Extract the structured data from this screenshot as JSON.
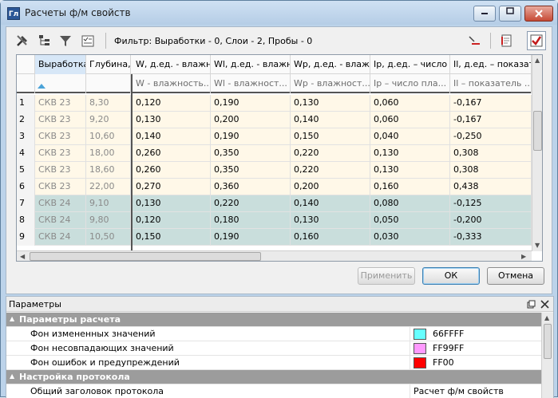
{
  "window": {
    "title": "Расчеты ф/м свойств",
    "app_icon_text": "Гл"
  },
  "toolbar": {
    "filter_text": "Фильтр: Выработки - 0, Слои - 2, Пробы - 0",
    "icons": [
      "hammer-wrench-icon",
      "tree-icon",
      "funnel-icon",
      "checklist-icon",
      "list-sort-icon",
      "report-icon",
      "checkbox-icon"
    ]
  },
  "grid": {
    "columns": [
      {
        "header": "Выработка",
        "sub": ""
      },
      {
        "header": "Глубина,",
        "sub": ""
      },
      {
        "header": "W, д.ед. - влажно",
        "sub": "W - влажность..."
      },
      {
        "header": "Wl, д.ед.  - влажн",
        "sub": "Wl - влажност..."
      },
      {
        "header": "Wp, д.ед. - влажн",
        "sub": "Wp - влажност..."
      },
      {
        "header": "Ip, д.ед. – число г",
        "sub": "Ip – число пла..."
      },
      {
        "header": "Il, д.ед. – показат",
        "sub": "Il – показатель ..."
      }
    ],
    "rows": [
      {
        "n": "1",
        "cells": [
          "СКВ 23",
          "8,30",
          "0,120",
          "0,190",
          "0,130",
          "0,060",
          "-0,167"
        ],
        "group": "g1"
      },
      {
        "n": "2",
        "cells": [
          "СКВ 23",
          "9,20",
          "0,130",
          "0,200",
          "0,140",
          "0,060",
          "-0,167"
        ],
        "group": "g1"
      },
      {
        "n": "3",
        "cells": [
          "СКВ 23",
          "10,60",
          "0,140",
          "0,190",
          "0,150",
          "0,040",
          "-0,250"
        ],
        "group": "g1"
      },
      {
        "n": "4",
        "cells": [
          "СКВ 23",
          "18,00",
          "0,260",
          "0,350",
          "0,220",
          "0,130",
          "0,308"
        ],
        "group": "g1"
      },
      {
        "n": "5",
        "cells": [
          "СКВ 23",
          "18,60",
          "0,260",
          "0,350",
          "0,220",
          "0,130",
          "0,308"
        ],
        "group": "g1"
      },
      {
        "n": "6",
        "cells": [
          "СКВ 23",
          "22,00",
          "0,270",
          "0,360",
          "0,200",
          "0,160",
          "0,438"
        ],
        "group": "g1"
      },
      {
        "n": "7",
        "cells": [
          "СКВ 24",
          "9,10",
          "0,130",
          "0,220",
          "0,140",
          "0,080",
          "-0,125"
        ],
        "group": "g2"
      },
      {
        "n": "8",
        "cells": [
          "СКВ 24",
          "9,80",
          "0,120",
          "0,180",
          "0,130",
          "0,050",
          "-0,200"
        ],
        "group": "g2"
      },
      {
        "n": "9",
        "cells": [
          "СКВ 24",
          "10,50",
          "0,150",
          "0,190",
          "0,160",
          "0,030",
          "-0,333"
        ],
        "group": "g2"
      }
    ]
  },
  "buttons": {
    "apply": "Применить",
    "ok": "ОК",
    "cancel": "Отмена"
  },
  "params": {
    "title": "Параметры",
    "sections": [
      {
        "title": "Параметры расчета",
        "items": [
          {
            "label": "Фон измененных значений",
            "value": "66FFFF",
            "color": "#66FFFF"
          },
          {
            "label": "Фон несовпадающих значений",
            "value": "FF99FF",
            "color": "#FF99FF"
          },
          {
            "label": "Фон ошибок и предупреждений",
            "value": "FF00",
            "color": "#FF0000"
          }
        ]
      },
      {
        "title": "Настройка протокола",
        "items": [
          {
            "label": "Общий заголовок протокола",
            "value": "Расчет ф/м свойств"
          }
        ]
      }
    ]
  }
}
